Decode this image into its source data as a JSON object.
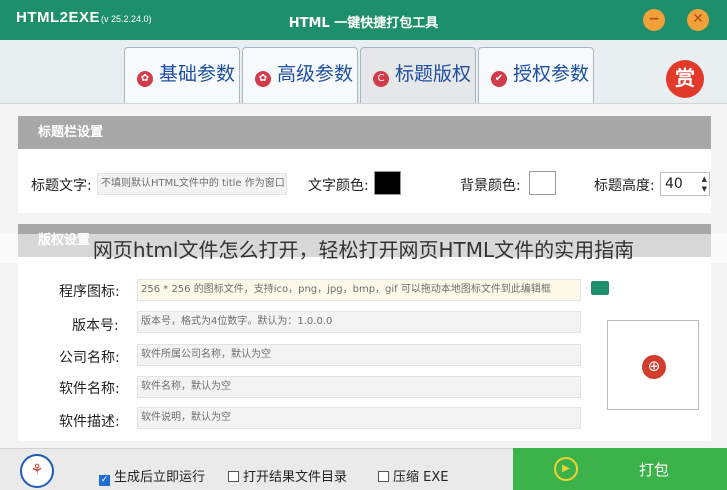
{
  "app": {
    "name": "HTML2EXE",
    "version": "(v 25.2.24.0)",
    "window_title": "HTML 一键快捷打包工具",
    "minimize_glyph": "−",
    "close_glyph": "✕"
  },
  "tabs": [
    {
      "label": "基础参数",
      "icon": "gear-icon"
    },
    {
      "label": "高级参数",
      "icon": "gear-icon"
    },
    {
      "label": "标题版权",
      "icon": "copyright-icon",
      "active": true
    },
    {
      "label": "授权参数",
      "icon": "shield-icon"
    }
  ],
  "reward_button": "赏",
  "titlebar_section": {
    "heading": "标题栏设置",
    "title_text_label": "标题文字:",
    "title_text_placeholder": "不填则默认HTML文件中的 title 作为窗口",
    "text_color_label": "文字颜色:",
    "text_color": "#000000",
    "bg_color_label": "背景颜色:",
    "bg_color": "#ffffff",
    "height_label": "标题高度:",
    "height_value": "40"
  },
  "overlay_text": "网页html文件怎么打开，轻松打开网页HTML文件的实用指南",
  "version_section": {
    "heading": "版权设置",
    "icon_label": "程序图标:",
    "icon_placeholder": "256 * 256 的图标文件，支持ico，png，jpg，bmp，gif   可以拖动本地图标文件到此编辑框",
    "version_label": "版本号:",
    "version_placeholder": "版本号，格式为4位数字。默认为：1.0.0.0",
    "company_label": "公司名称:",
    "company_placeholder": "软件所属公司名称，默认为空",
    "software_label": "软件名称:",
    "software_placeholder": "软件名称，默认为空",
    "description_label": "软件描述:",
    "description_placeholder": "软件说明，默认为空"
  },
  "bottom": {
    "options": [
      {
        "label": "生成后立即运行",
        "checked": true
      },
      {
        "label": "打开结果文件目录",
        "checked": false
      },
      {
        "label": "压缩 EXE",
        "checked": false
      }
    ],
    "pack_label": "打包"
  },
  "colors": {
    "titlebar": "#1d8f6a",
    "tab_text": "#1f4fa0",
    "pack_button": "#3cb34a",
    "reward": "#e23a2a"
  }
}
